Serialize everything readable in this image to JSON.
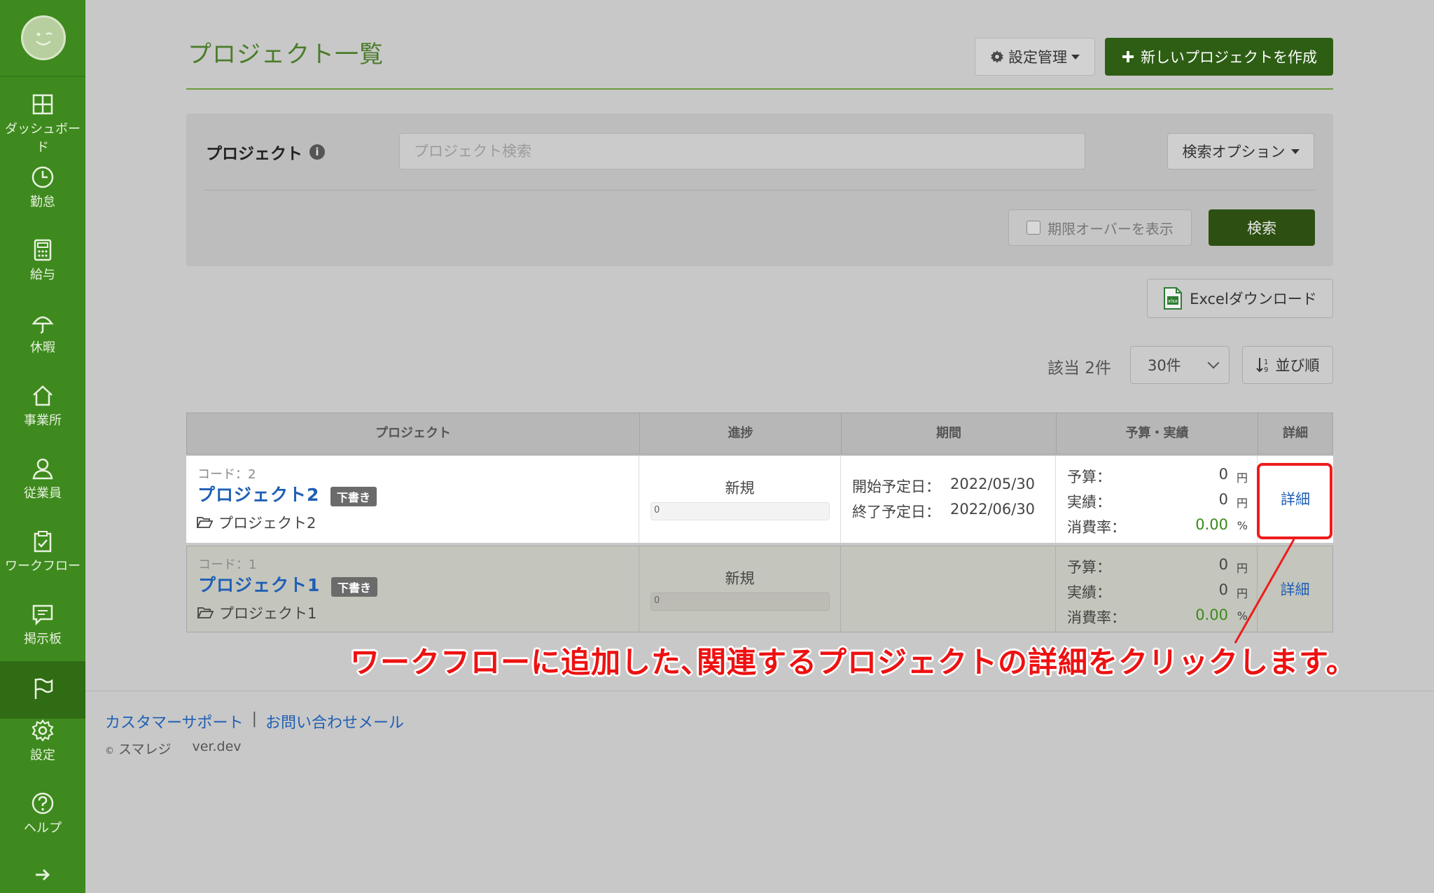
{
  "sidebar": {
    "items": [
      {
        "label": "ダッシュボード",
        "icon": "dashboard-icon"
      },
      {
        "label": "勤怠",
        "icon": "clock-icon"
      },
      {
        "label": "給与",
        "icon": "calculator-icon"
      },
      {
        "label": "休暇",
        "icon": "umbrella-icon"
      },
      {
        "label": "事業所",
        "icon": "home-icon"
      },
      {
        "label": "従業員",
        "icon": "person-icon"
      },
      {
        "label": "ワークフロー",
        "icon": "checklist-icon"
      },
      {
        "label": "掲示板",
        "icon": "chat-icon"
      },
      {
        "label": "",
        "icon": "flag-icon"
      },
      {
        "label": "設定",
        "icon": "gear-icon"
      },
      {
        "label": "ヘルプ",
        "icon": "help-icon"
      }
    ]
  },
  "header": {
    "title": "プロジェクト一覧",
    "settings_label": "設定管理",
    "new_project_label": "新しいプロジェクトを作成"
  },
  "search": {
    "label": "プロジェクト",
    "placeholder": "プロジェクト検索",
    "options_label": "検索オプション",
    "overdue_label": "期限オーバーを表示",
    "search_button": "検索"
  },
  "toolbar": {
    "excel_label": "Excelダウンロード",
    "count_text": "該当 2件",
    "per_page": "30件",
    "sort_label": "並び順"
  },
  "table": {
    "headers": [
      "プロジェクト",
      "進捗",
      "期間",
      "予算・実績",
      "詳細"
    ],
    "rows": [
      {
        "code": "コード：2",
        "name": "プロジェクト2",
        "badge": "下書き",
        "folder": "プロジェクト2",
        "progress_label": "新規",
        "progress_value": 0,
        "progress_text": "0",
        "start_label": "開始予定日：",
        "start_date": "2022/05/30",
        "end_label": "終了予定日：",
        "end_date": "2022/06/30",
        "budget_label": "予算：",
        "budget_value": "0",
        "actual_label": "実績：",
        "actual_value": "0",
        "rate_label": "消費率：",
        "rate_value": "0.00",
        "yen": "円",
        "percent": "%",
        "detail": "詳細"
      },
      {
        "code": "コード：1",
        "name": "プロジェクト1",
        "badge": "下書き",
        "folder": "プロジェクト1",
        "progress_label": "新規",
        "progress_value": 0,
        "progress_text": "0",
        "budget_label": "予算：",
        "budget_value": "0",
        "actual_label": "実績：",
        "actual_value": "0",
        "rate_label": "消費率：",
        "rate_value": "0.00",
        "yen": "円",
        "percent": "%",
        "detail": "詳細"
      }
    ]
  },
  "annotation": "ワークフローに追加した､関連するプロジェクトの詳細をクリックします。",
  "footer": {
    "support_link": "カスタマーサポート",
    "separator": "|",
    "mail_link": "お問い合わせメール",
    "copyright_symbol": "©",
    "brand": "スマレジ",
    "version": "ver.dev"
  },
  "colors": {
    "sidebar": "#3e8a1e",
    "primary_button": "#2d5e14",
    "link": "#1f5fb5",
    "annotation": "#ee1111"
  }
}
